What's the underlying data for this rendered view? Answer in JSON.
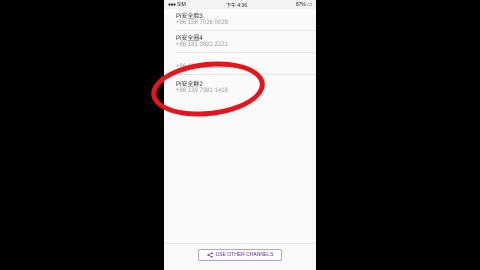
{
  "status_bar": {
    "carrier": "SIM",
    "time": "下午 4:36",
    "battery": "87%"
  },
  "contacts": [
    {
      "name": "Pi安全脸3",
      "number": "+86 158 7026 0029"
    },
    {
      "name": "Pi安全圈4",
      "number": "+86 181 3822 2221"
    },
    {
      "name": "",
      "number": "+86 181 0600 5990"
    },
    {
      "name": "Pi安全群2",
      "number": "+86 139 7381 1418"
    }
  ],
  "footer": {
    "button_label": "USE OTHER CHANNELS",
    "button_icon": "share-icon"
  },
  "colors": {
    "annotation_circle": "#e8141b",
    "button_accent": "#5b2d8e"
  }
}
